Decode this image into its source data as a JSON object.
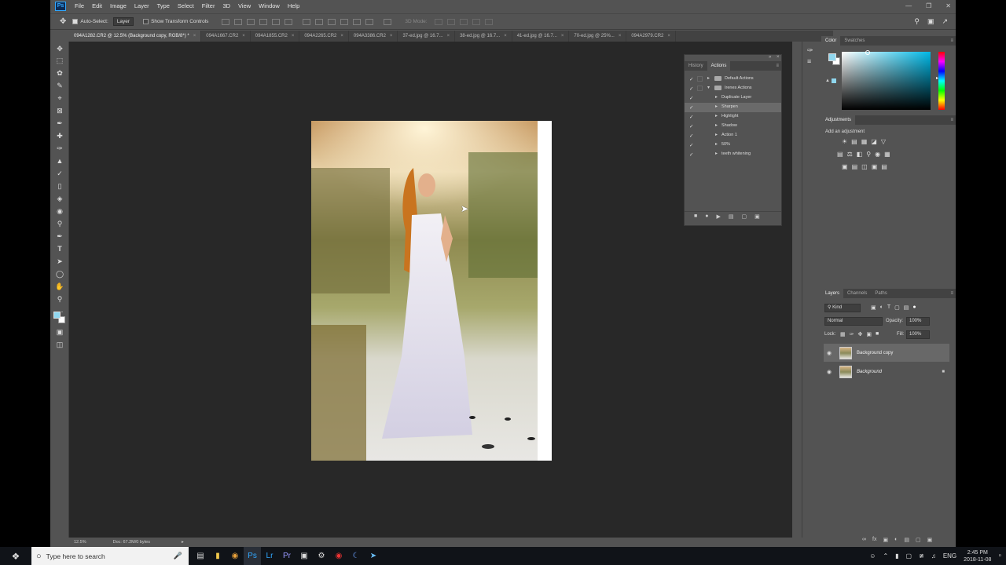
{
  "app": {
    "logo": "Ps",
    "menu": [
      "File",
      "Edit",
      "Image",
      "Layer",
      "Type",
      "Select",
      "Filter",
      "3D",
      "View",
      "Window",
      "Help"
    ]
  },
  "options": {
    "auto_select": "Auto-Select:",
    "auto_select_target": "Layer",
    "show_transform": "Show Transform Controls",
    "mode_3d": "3D Mode:"
  },
  "tabs": [
    "094A1282.CR2 @ 12.5% (Background copy, RGB/8*) *",
    "094A1667.CR2",
    "094A1855.CR2",
    "094A2265.CR2",
    "094A3386.CR2",
    "37-ed.jpg @ 16.7...",
    "38-ed.jpg @ 16.7...",
    "41-ed.jpg @ 16.7...",
    "70-ed.jpg @ 25%...",
    "094A2979.CR2"
  ],
  "status": {
    "zoom": "12.5%",
    "doc": "Doc: 67.2M/0 bytes"
  },
  "actions_panel": {
    "tabs": [
      "History",
      "Actions"
    ],
    "rows": [
      {
        "label": "Default Actions",
        "type": "set",
        "expanded": false
      },
      {
        "label": "Irenes Actions",
        "type": "set",
        "expanded": true
      },
      {
        "label": "Duplicate Layer",
        "type": "action"
      },
      {
        "label": "Sharpen",
        "type": "action",
        "selected": true
      },
      {
        "label": "Highlight",
        "type": "action"
      },
      {
        "label": "Shadow",
        "type": "action"
      },
      {
        "label": "Action 1",
        "type": "action"
      },
      {
        "label": "50%",
        "type": "action"
      },
      {
        "label": "teeth whitening",
        "type": "action"
      }
    ]
  },
  "color_panel": {
    "tabs": [
      "Color",
      "Swatches"
    ],
    "foreground": "#8fd6ee",
    "hue": "#00b8e6"
  },
  "adjustments_panel": {
    "title": "Adjustments",
    "subtitle": "Add an adjustment"
  },
  "layers_panel": {
    "tabs": [
      "Layers",
      "Channels",
      "Paths"
    ],
    "filter": "Kind",
    "blend_mode": "Normal",
    "opacity_label": "Opacity:",
    "opacity": "100%",
    "lock_label": "Lock:",
    "fill_label": "Fill:",
    "fill": "100%",
    "layers": [
      {
        "name": "Background copy",
        "selected": true
      },
      {
        "name": "Background",
        "locked": true
      }
    ]
  },
  "taskbar": {
    "search_placeholder": "Type here to search",
    "lang": "ENG",
    "time": "2:45 PM",
    "date": "2018-11-08"
  }
}
